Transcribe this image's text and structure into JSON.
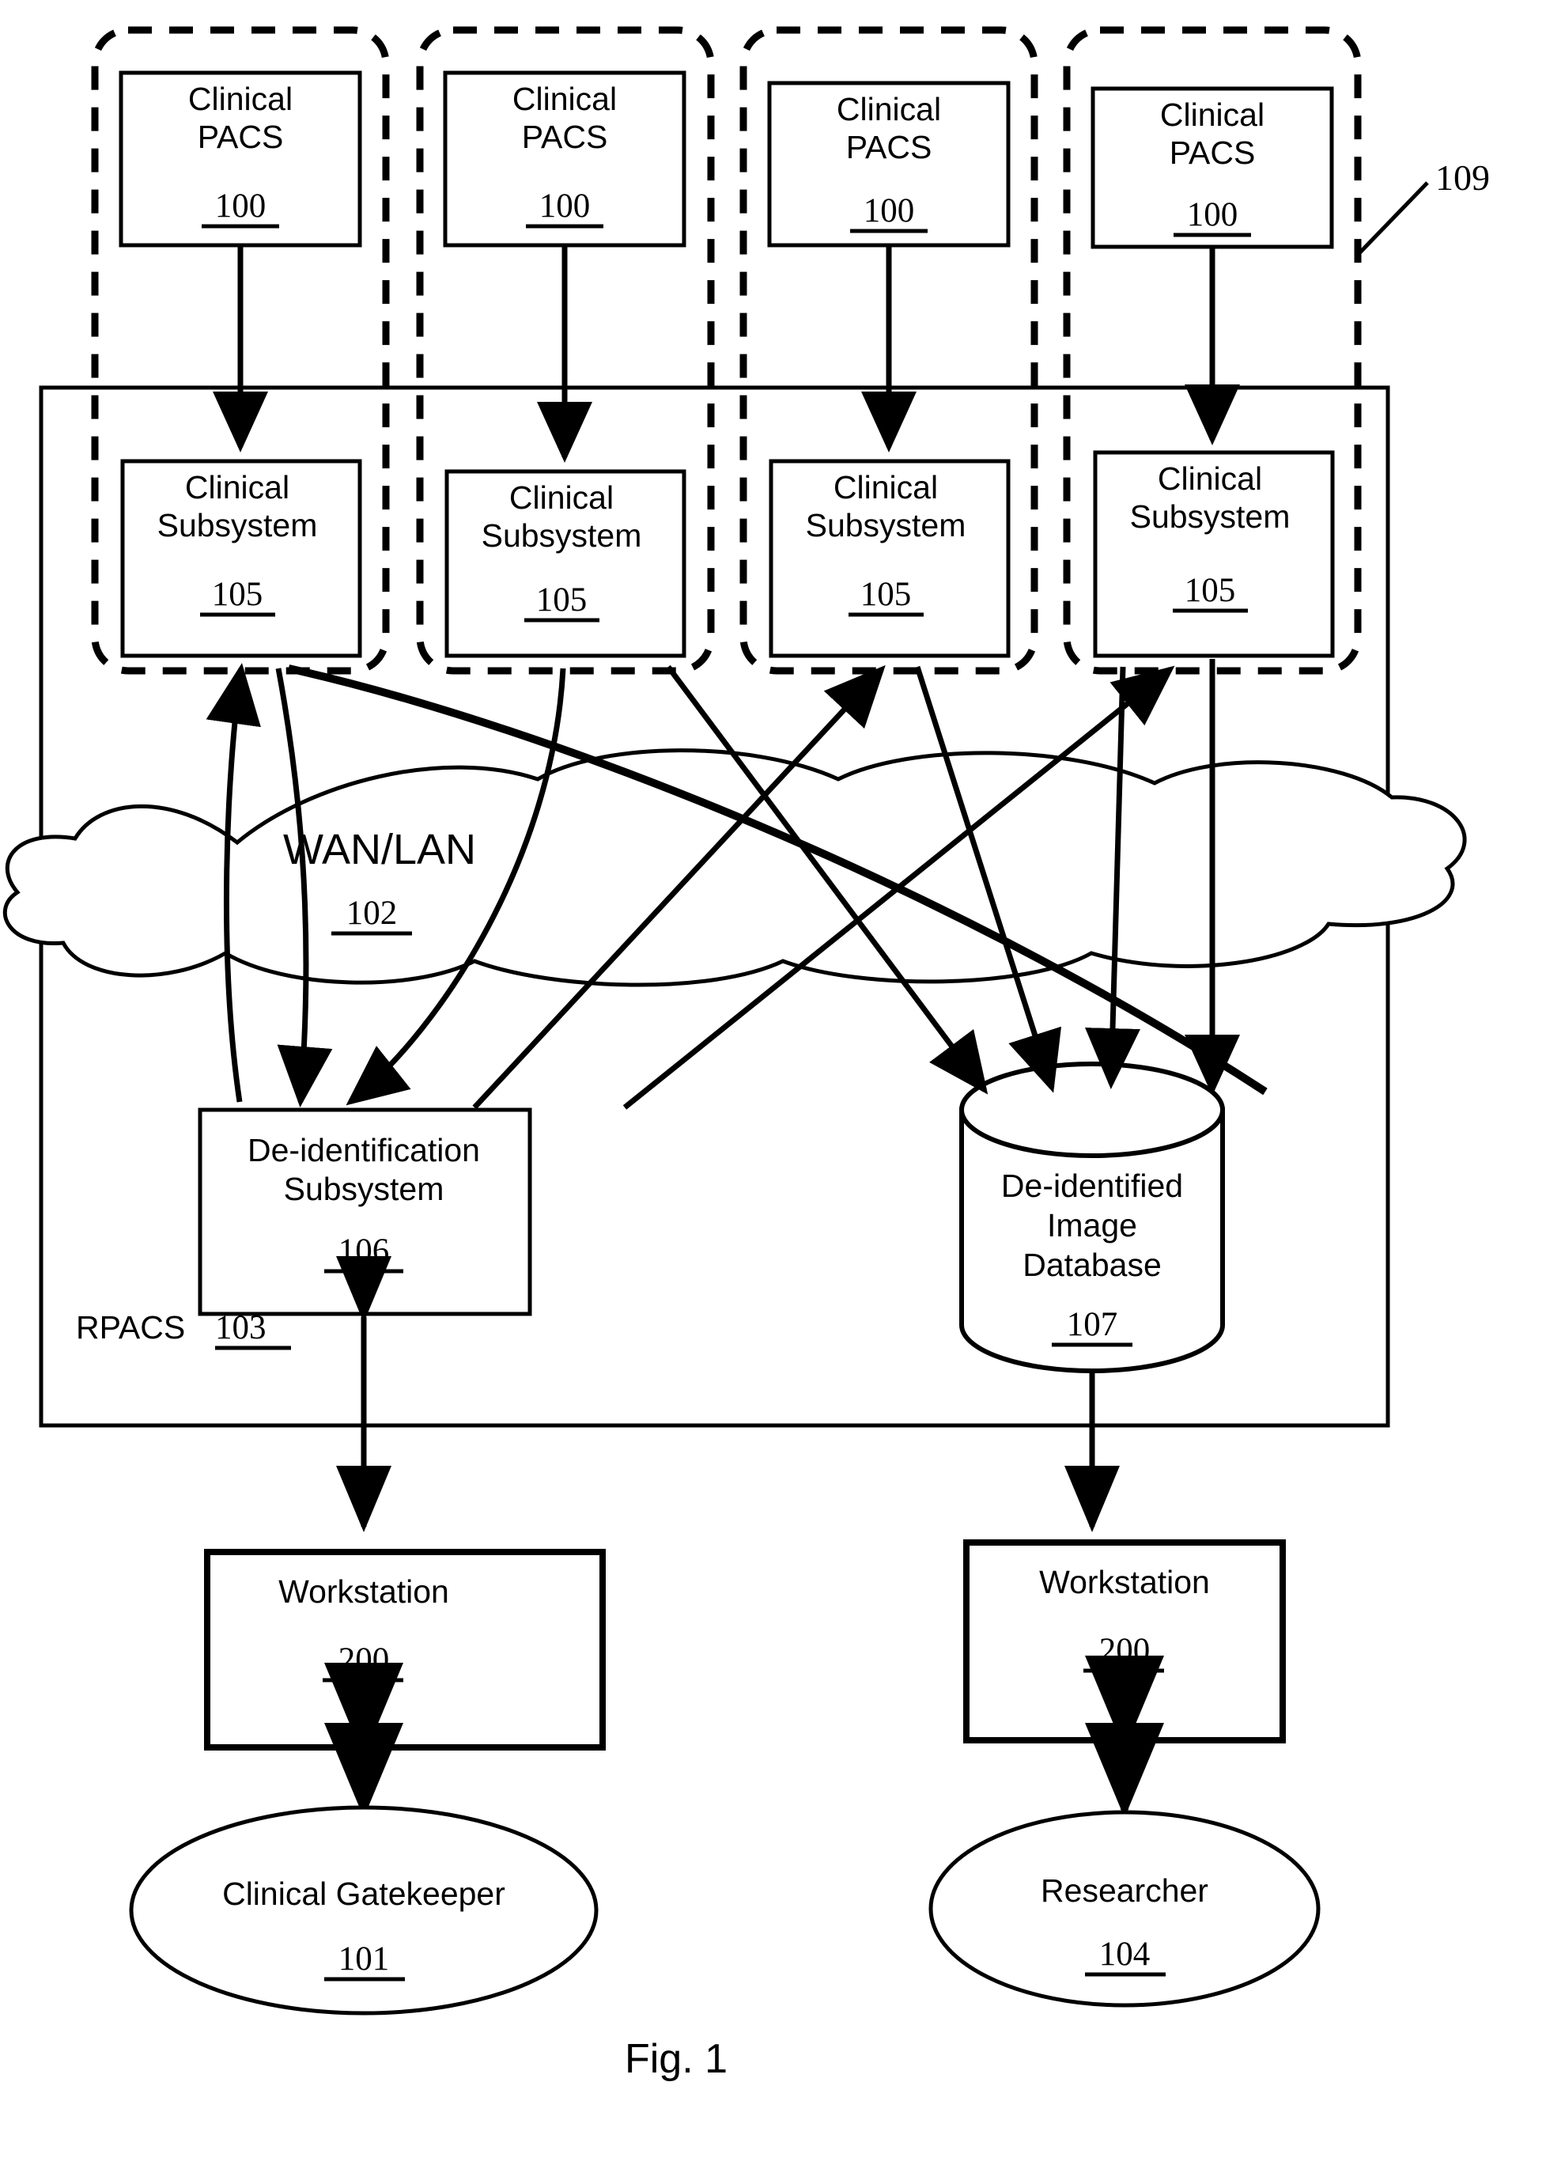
{
  "figure": {
    "caption": "Fig. 1",
    "group_callout": "109",
    "container": {
      "label": "RPACS",
      "ref": "103"
    }
  },
  "pacs_row": [
    {
      "line1": "Clinical",
      "line2": "PACS",
      "ref": "100"
    },
    {
      "line1": "Clinical",
      "line2": "PACS",
      "ref": "100"
    },
    {
      "line1": "Clinical",
      "line2": "PACS",
      "ref": "100"
    },
    {
      "line1": "Clinical",
      "line2": "PACS",
      "ref": "100"
    }
  ],
  "subsystem_row": [
    {
      "line1": "Clinical",
      "line2": "Subsystem",
      "ref": "105"
    },
    {
      "line1": "Clinical",
      "line2": "Subsystem",
      "ref": "105"
    },
    {
      "line1": "Clinical",
      "line2": "Subsystem",
      "ref": "105"
    },
    {
      "line1": "Clinical",
      "line2": "Subsystem",
      "ref": "105"
    }
  ],
  "network": {
    "label": "WAN/LAN",
    "ref": "102"
  },
  "deident": {
    "line1": "De-identification",
    "line2": "Subsystem",
    "ref": "106"
  },
  "database": {
    "line1": "De-identified",
    "line2": "Image",
    "line3": "Database",
    "ref": "107"
  },
  "workstation_left": {
    "label": "Workstation",
    "ref": "200"
  },
  "workstation_right": {
    "label": "Workstation",
    "ref": "200"
  },
  "actor_left": {
    "label": "Clinical Gatekeeper",
    "ref": "101"
  },
  "actor_right": {
    "label": "Researcher",
    "ref": "104"
  }
}
